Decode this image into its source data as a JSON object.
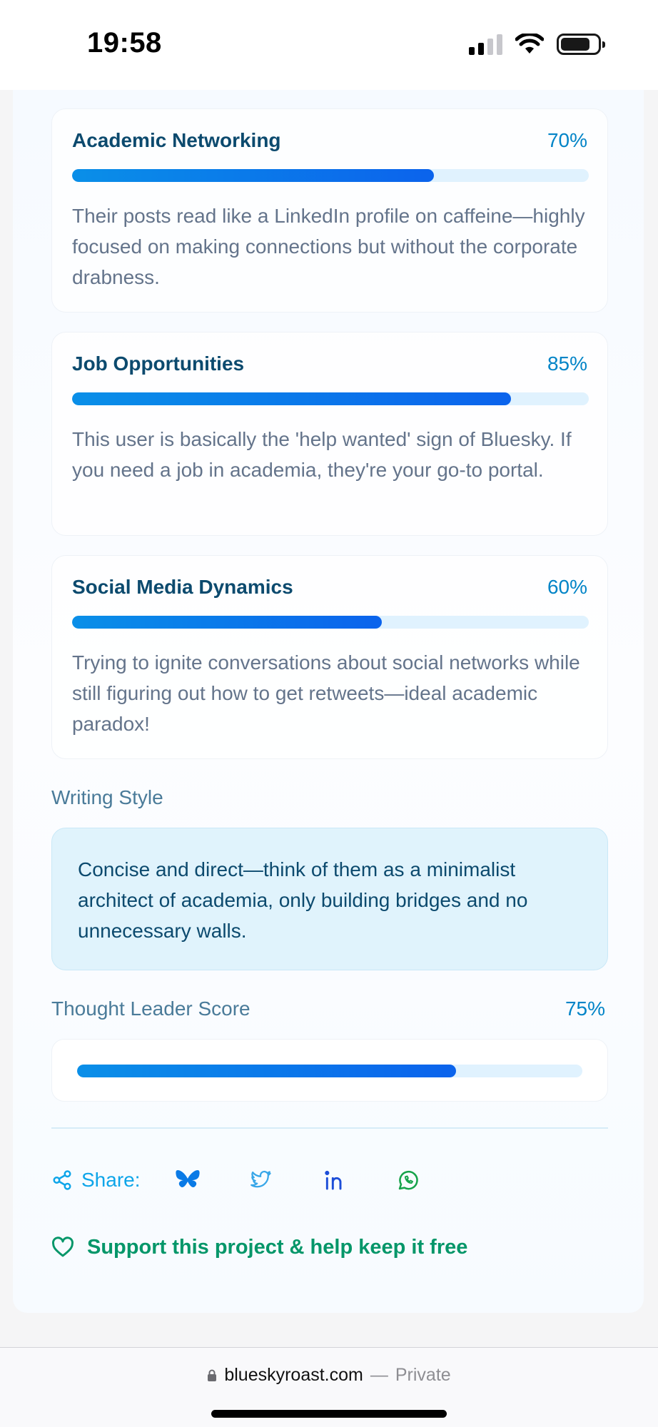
{
  "status_bar": {
    "time": "19:58",
    "icons": [
      "cellular-signal-icon",
      "wifi-icon",
      "battery-icon"
    ]
  },
  "sections": [
    {
      "title": "Academic Networking",
      "percent_label": "70%",
      "percent": 70,
      "description": "Their posts read like a LinkedIn profile on caffeine—highly focused on making connections but without the corporate drabness."
    },
    {
      "title": "Job Opportunities",
      "percent_label": "85%",
      "percent": 85,
      "description": "This user is basically the 'help wanted' sign of Bluesky. If you need a job in academia, they're your go-to portal."
    },
    {
      "title": "Social Media Dynamics",
      "percent_label": "60%",
      "percent": 60,
      "description": "Trying to ignite conversations about social networks while still figuring out how to get retweets—ideal academic paradox!"
    }
  ],
  "writing_style": {
    "heading": "Writing Style",
    "text": "Concise and direct—think of them as a minimalist architect of academia, only building bridges and no unnecessary walls."
  },
  "thought_leader": {
    "heading": "Thought Leader Score",
    "percent_label": "75%",
    "percent": 75
  },
  "share": {
    "label": "Share:",
    "icons": [
      "share-icon",
      "bluesky-icon",
      "twitter-icon",
      "linkedin-icon",
      "whatsapp-icon"
    ]
  },
  "support": {
    "label": "Support this project & help keep it free",
    "icon": "heart-icon"
  },
  "browser": {
    "domain": "blueskyroast.com",
    "separator": "—",
    "privacy": "Private",
    "icon": "lock-icon"
  },
  "colors": {
    "accent": "#0284c7",
    "bar_start": "#0a8fe8",
    "bar_end": "#0b63ec",
    "track": "#e0f2fe",
    "support_green": "#059669",
    "title_navy": "#0c4a6e",
    "body_gray": "#64748b"
  }
}
